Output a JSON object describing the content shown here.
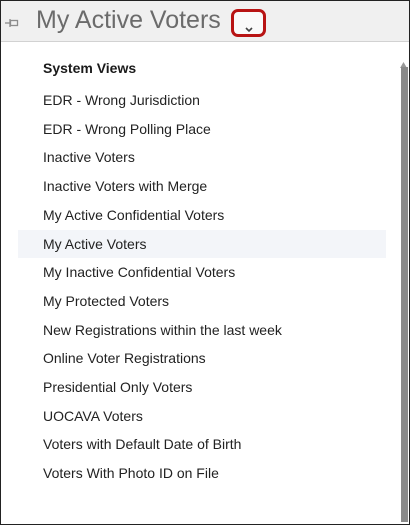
{
  "header": {
    "title": "My Active Voters",
    "pin_icon": "pin-icon",
    "dropdown_icon": "chevron-down-icon",
    "highlight_color": "#b81414"
  },
  "list": {
    "section_title": "System Views",
    "selected_index": 6,
    "items": [
      "EDR - Wrong Jurisdiction",
      "EDR - Wrong Polling Place",
      "Inactive Voters",
      "Inactive Voters with Merge",
      "My Active Confidential Voters",
      "My Active Voters",
      "My Inactive Confidential Voters",
      "My Protected Voters",
      "New Registrations within the last week",
      "Online Voter Registrations",
      "Presidential Only Voters",
      "UOCAVA Voters",
      "Voters with Default Date of Birth",
      "Voters With Photo ID on File"
    ]
  }
}
